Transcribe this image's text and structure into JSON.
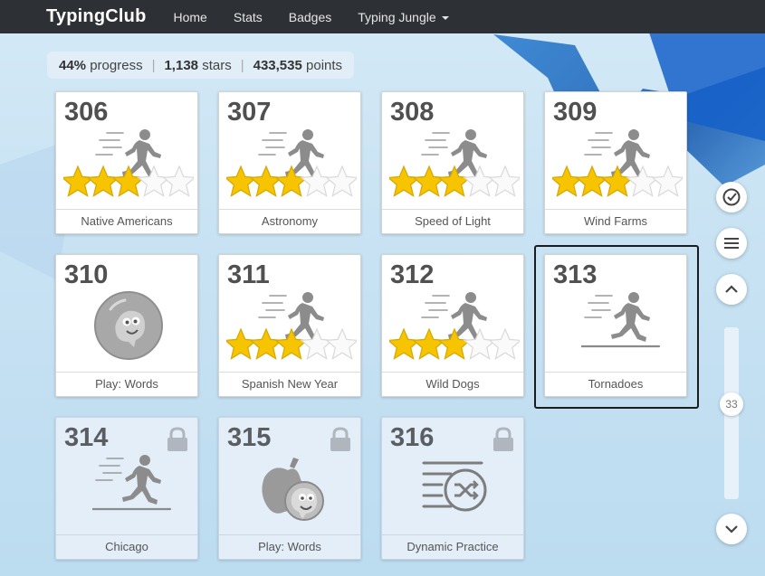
{
  "app": {
    "logo": "TypingClub"
  },
  "nav": {
    "items": [
      "Home",
      "Stats",
      "Badges",
      "Typing Jungle"
    ]
  },
  "summary": {
    "progress": "44%",
    "progress_label": "progress",
    "stars": "1,138",
    "stars_label": "stars",
    "points": "433,535",
    "points_label": "points"
  },
  "lessons": [
    {
      "number": "306",
      "title": "Native Americans",
      "type": "runner",
      "stars": 3,
      "locked": false
    },
    {
      "number": "307",
      "title": "Astronomy",
      "type": "runner",
      "stars": 3,
      "locked": false
    },
    {
      "number": "308",
      "title": "Speed of Light",
      "type": "runner",
      "stars": 3,
      "locked": false
    },
    {
      "number": "309",
      "title": "Wind Farms",
      "type": "runner",
      "stars": 3,
      "locked": false
    },
    {
      "number": "310",
      "title": "Play: Words",
      "type": "game-bubble",
      "stars": 0,
      "locked": false
    },
    {
      "number": "311",
      "title": "Spanish New Year",
      "type": "runner",
      "stars": 3,
      "locked": false
    },
    {
      "number": "312",
      "title": "Wild Dogs",
      "type": "runner",
      "stars": 3,
      "locked": false
    },
    {
      "number": "313",
      "title": "Tornadoes",
      "type": "runner-plain",
      "stars": 0,
      "locked": false,
      "selected": true
    },
    {
      "number": "314",
      "title": "Chicago",
      "type": "runner-plain",
      "stars": 0,
      "locked": true
    },
    {
      "number": "315",
      "title": "Play: Words",
      "type": "game-apple",
      "stars": 0,
      "locked": true
    },
    {
      "number": "316",
      "title": "Dynamic Practice",
      "type": "shuffle-icon",
      "stars": 0,
      "locked": true
    }
  ],
  "sidebar": {
    "scroll_value": "33",
    "icons": [
      "check-circle-icon",
      "menu-icon",
      "chevron-up-icon",
      "chevron-down-icon"
    ]
  },
  "colors": {
    "topbar": "#2d3035",
    "star_filled": "#f6c400",
    "star_empty": "#fafafa",
    "icon_gray": "#8c8c8c"
  }
}
